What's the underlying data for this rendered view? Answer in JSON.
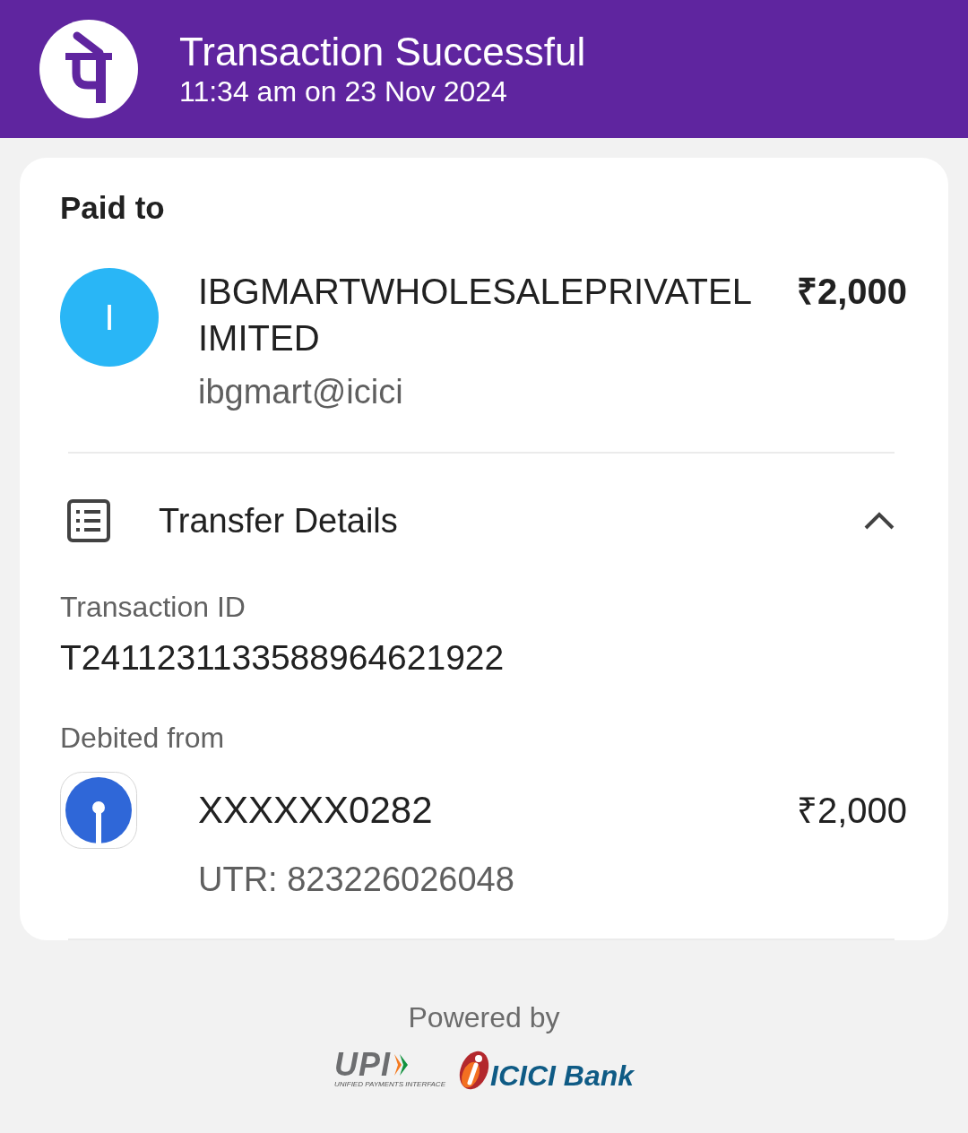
{
  "header": {
    "title": "Transaction Successful",
    "timestamp": "11:34 am on 23 Nov 2024"
  },
  "paid_to": {
    "heading": "Paid to",
    "avatar_letter": "I",
    "name": "IBGMARTWHOLESALEPRIVATELIMITED",
    "amount": "₹2,000",
    "upi_id": "ibgmart@icici"
  },
  "transfer_details": {
    "title": "Transfer Details",
    "expanded": true,
    "fields": [
      {
        "label": "Transaction ID",
        "value": "T2411231133588964621922"
      }
    ],
    "debited_from": {
      "label": "Debited from",
      "account": "XXXXXX0282",
      "amount": "₹2,000",
      "utr": "UTR: 823226026048"
    }
  },
  "footer": {
    "powered_by": "Powered by",
    "upi_logo": {
      "mark": "UPI",
      "tagline": "UNIFIED PAYMENTS INTERFACE"
    },
    "bank_logo": "ICICI Bank"
  }
}
